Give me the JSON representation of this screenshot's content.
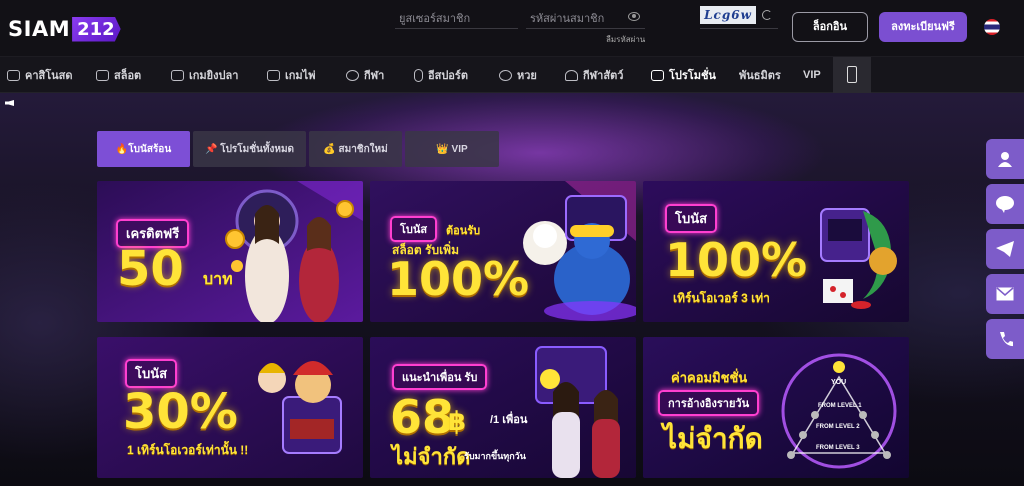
{
  "header": {
    "logo_text": "SIAM",
    "logo_num": "212",
    "username_placeholder": "ยูสเซอร์สมาชิก",
    "password_placeholder": "รหัสผ่านสมาชิก",
    "forgot_password": "ลืมรหัสผ่าน",
    "captcha": "Lcg6w",
    "login_label": "ล็อกอิน",
    "register_label": "ลงทะเบียนฟรี",
    "language_icon": "thai-flag-icon"
  },
  "nav": {
    "items": [
      {
        "label": "คาสิโนสด",
        "icon": "casino-icon"
      },
      {
        "label": "สล็อต",
        "icon": "slot-icon"
      },
      {
        "label": "เกมยิงปลา",
        "icon": "fish-icon"
      },
      {
        "label": "เกมไพ่",
        "icon": "cards-icon"
      },
      {
        "label": "กีฬา",
        "icon": "soccer-ball-icon"
      },
      {
        "label": "อีสปอร์ต",
        "icon": "mouse-icon"
      },
      {
        "label": "หวย",
        "icon": "lottery-icon"
      },
      {
        "label": "กีฬาสัตว์",
        "icon": "rooster-icon"
      },
      {
        "label": "โปรโมชั่น",
        "icon": "gift-icon"
      },
      {
        "label": "พันธมิตร",
        "icon": ""
      },
      {
        "label": "VIP",
        "icon": ""
      }
    ],
    "mobile_icon": "mobile-phone-icon"
  },
  "tabs": [
    {
      "label": "🔥โบนัสร้อน",
      "active": true
    },
    {
      "label": "📌 โปรโมชั่นทั้งหมด",
      "active": false
    },
    {
      "label": "💰 สมาชิกใหม่",
      "active": false
    },
    {
      "label": "👑 VIP",
      "active": false
    }
  ],
  "cards": [
    {
      "pill": "เครดิตฟรี",
      "big": "50",
      "unit": "บาท"
    },
    {
      "pill": "โบนัส",
      "sub_pill": "ต้อนรับ",
      "line": "สล็อต รับเพิ่ม",
      "big": "100%"
    },
    {
      "pill": "โบนัส",
      "big": "100%",
      "line": "เทิร์นโอเวอร์ 3 เท่า"
    },
    {
      "pill": "โบนัส",
      "big": "30%",
      "line": "1 เทิร์นโอเวอร์เท่านั้น !!"
    },
    {
      "pill": "แนะนำเพื่อน รับ",
      "big": "68",
      "unit": "฿",
      "per": "/1 เพื่อน",
      "line": "ไม่จำกัด",
      "sub": "รับมากขึ้นทุกวัน"
    },
    {
      "line1": "ค่าคอมมิชชั่น",
      "pill": "การอ้างอิงรายวัน",
      "line": "ไม่จำกัด",
      "you": "YOU",
      "levels": [
        "FROM LEVEL 1",
        "FROM LEVEL 2",
        "FROM LEVEL 3"
      ]
    }
  ],
  "side_buttons": [
    "user-icon",
    "line-icon",
    "telegram-icon",
    "email-icon",
    "phone-icon"
  ],
  "colors": {
    "accent": "#7b4fd1",
    "gold": "#ffe438",
    "neon_pink": "#ff3fd0"
  }
}
